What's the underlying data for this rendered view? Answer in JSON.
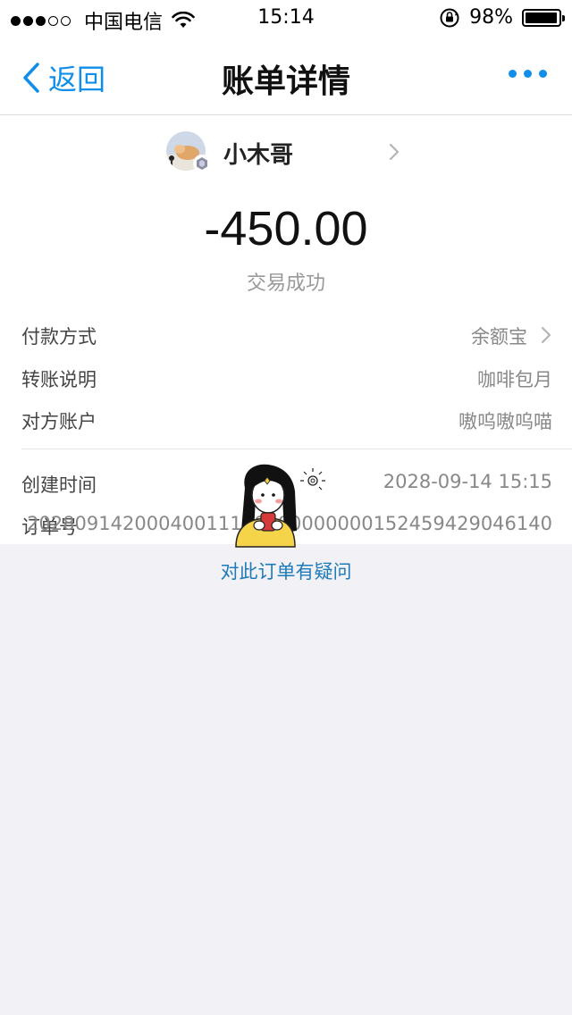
{
  "status_bar": {
    "signal_dots": [
      "full",
      "full",
      "full",
      "empty",
      "empty"
    ],
    "carrier": "中国电信",
    "time": "15:14",
    "battery_percent_text": "98%",
    "battery_level": 0.98
  },
  "nav": {
    "back_label": "返回",
    "title": "账单详情"
  },
  "payee": {
    "name": "小木哥"
  },
  "transaction": {
    "amount": "-450.00",
    "status": "交易成功"
  },
  "details": [
    {
      "label": "付款方式",
      "value": "余额宝"
    },
    {
      "label": "转账说明",
      "value": "咖啡包月"
    },
    {
      "label": "对方账户",
      "value": "嗷呜嗷呜喵"
    }
  ],
  "meta": [
    {
      "label": "创建时间",
      "value": "2028-09-14 15:15"
    },
    {
      "label": "订单号",
      "value": "20280914200040011100000000000152459429046140"
    }
  ],
  "question_link": "对此订单有疑问",
  "colors": {
    "accent": "#108ee9",
    "link": "#1e7ab8",
    "background": "#f2f2f6"
  }
}
